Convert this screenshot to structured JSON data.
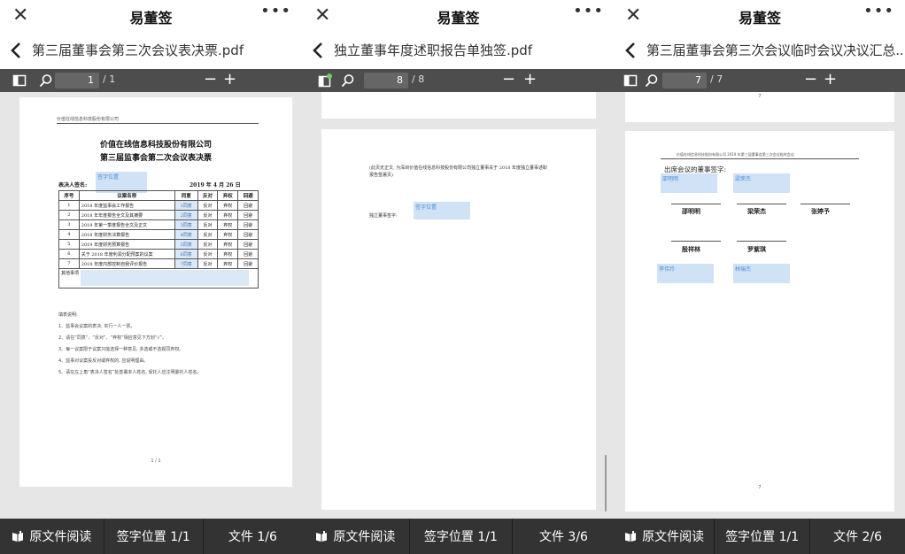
{
  "app_title": "易董签",
  "panels": [
    {
      "file_name": "第三届董事会第三次会议表决票.pdf",
      "page_current": "1",
      "page_total": "/ 1",
      "bottom": {
        "read": "原文件阅读",
        "sign_pos": "签字位置 1/1",
        "file": "文件 1/6"
      },
      "doc": {
        "header": "价值在线信息科技股份有限公司",
        "title": "价值在线信息科技股份有限公司",
        "subtitle": "第三届监事会第二次会议表决票",
        "voter_label": "表决人签名:",
        "sig_label": "签字位置",
        "date": "2019 年 4 月 26 日",
        "columns": [
          "序号",
          "议案名称",
          "同意",
          "反对",
          "弃权",
          "回避"
        ],
        "rows": [
          {
            "no": "1",
            "name": "2018 年度监事会工作报告",
            "agree": "1同意",
            "oppose": "反对",
            "abstain": "弃权",
            "avoid": "回避"
          },
          {
            "no": "2",
            "name": "2018 年年度报告全文及其摘要",
            "agree": "2同意",
            "oppose": "反对",
            "abstain": "弃权",
            "avoid": "回避"
          },
          {
            "no": "3",
            "name": "2019 年第一季度报告全文及正文",
            "agree": "3同意",
            "oppose": "反对",
            "abstain": "弃权",
            "avoid": "回避"
          },
          {
            "no": "4",
            "name": "2018 年度财务决算报告",
            "agree": "4同意",
            "oppose": "反对",
            "abstain": "弃权",
            "avoid": "回避"
          },
          {
            "no": "5",
            "name": "2019 年度财务预算报告",
            "agree": "5同意",
            "oppose": "反对",
            "abstain": "弃权",
            "avoid": "回避"
          },
          {
            "no": "6",
            "name": "关于 2018 年度利润分配预案的议案",
            "agree": "6同意",
            "oppose": "反对",
            "abstain": "弃权",
            "avoid": "回避"
          },
          {
            "no": "7",
            "name": "2018 年度内部控制自我评价报告",
            "agree": "7同意",
            "oppose": "反对",
            "abstain": "弃权",
            "avoid": "回避"
          }
        ],
        "other_label": "其他事项",
        "note_title": "填表说明:",
        "notes": [
          "1、监事会议案的表决, 实行一人一票。",
          "2、请在“同意”、“反对”、“弃权”相应意见下方划“√”。",
          "3、每一议案限于议案只能选择一种意见, 多选或不选视同弃权。",
          "4、监事对议案投反对或弃权的, 应说明理由。",
          "5、请在左上角“表决人签名”处签署本人姓名, 受托人应注明委托人姓名。"
        ],
        "footer": "1 / 1"
      }
    },
    {
      "file_name": "独立董事年度述职报告单独签.pdf",
      "page_current": "8",
      "page_total": "/ 8",
      "bottom": {
        "read": "原文件阅读",
        "sign_pos": "签字位置 1/1",
        "file": "文件 3/6"
      },
      "doc": {
        "line1": "(此页无正文, 为深圳价值在线信息科技股份有限公司独立董事关于 2018 年度独立董事述职",
        "line2": "报告签署页)",
        "sig_label": "签字位置",
        "signer_label": "独立董事签字:"
      }
    },
    {
      "file_name": "第三届董事会第三次会议临时会议决议汇总....pdf",
      "page_current": "7",
      "page_total": "/ 7",
      "bottom": {
        "read": "原文件阅读",
        "sign_pos": "签字位置 1/1",
        "file": "文件 2/6"
      },
      "doc": {
        "top_page_no": "7",
        "header": "价值在线信息科技股份有限公司 2019 年第三届董事会第三次会议临时会议",
        "attend_label": "出席会议的董事签字:",
        "sig1": "邵明明",
        "sig2": "梁荣杰",
        "sig3": "李伟玲",
        "sig4": "林瑞杰",
        "names_row1": [
          "邵明明",
          "梁荣杰",
          "张婷予"
        ],
        "names_row2": [
          "殷祥林",
          "罗紫琪"
        ],
        "page_no": "7"
      }
    }
  ]
}
